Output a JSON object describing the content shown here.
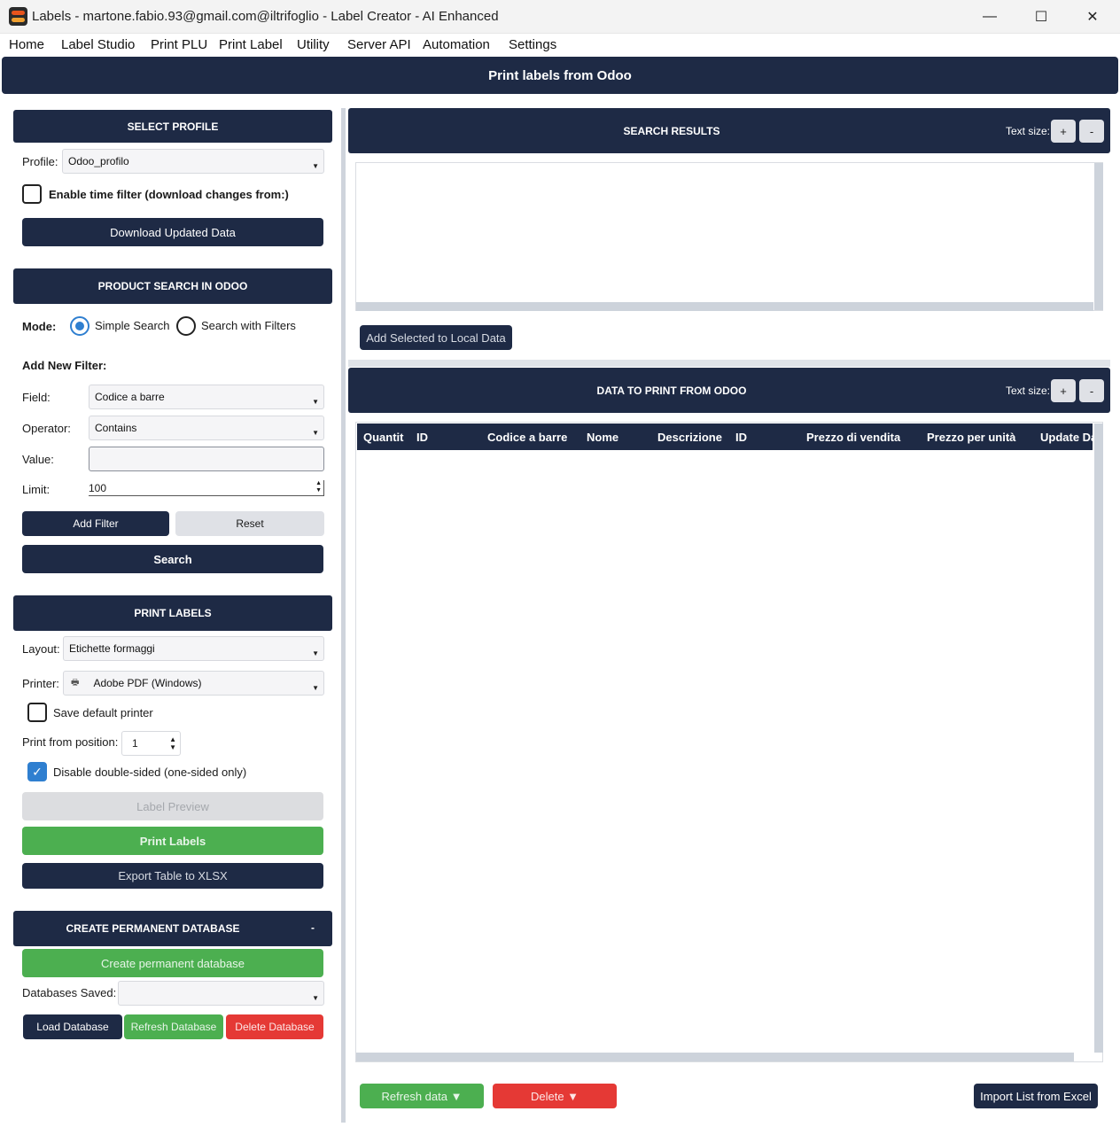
{
  "window": {
    "title": "Labels - martone.fabio.93@gmail.com@iltrifoglio - Label Creator - AI Enhanced",
    "minimize": "—",
    "maximize": "☐",
    "close": "✕"
  },
  "menu": [
    "Home",
    "Label Studio",
    "Print PLU",
    "Print Label",
    "Utility",
    "Server API",
    "Automation",
    "Settings"
  ],
  "header": {
    "title": "Print labels from Odoo"
  },
  "profile": {
    "section": "SELECT PROFILE",
    "label": "Profile:",
    "value": "Odoo_profilo",
    "time_filter_label": "Enable time filter (download changes from:)",
    "download_button": "Download Updated Data"
  },
  "search": {
    "section": "PRODUCT SEARCH IN ODOO",
    "mode_label": "Mode:",
    "mode_simple": "Simple Search",
    "mode_filters": "Search with Filters",
    "add_filter_title": "Add New Filter:",
    "field_label": "Field:",
    "field_value": "Codice a barre",
    "operator_label": "Operator:",
    "operator_value": "Contains",
    "value_label": "Value:",
    "value_value": "",
    "limit_label": "Limit:",
    "limit_value": "100",
    "add_filter_button": "Add Filter",
    "reset_button": "Reset",
    "search_button": "Search"
  },
  "print": {
    "section": "PRINT LABELS",
    "layout_label": "Layout:",
    "layout_value": "Etichette formaggi",
    "printer_label": "Printer:",
    "printer_value": "Adobe PDF (Windows)",
    "save_default_label": "Save default printer",
    "position_label": "Print from position:",
    "position_value": "1",
    "disable_double_label": "Disable double-sided (one-sided only)",
    "preview_button": "Label Preview",
    "print_button": "Print Labels",
    "export_button": "Export Table to XLSX"
  },
  "database": {
    "section": "CREATE PERMANENT DATABASE",
    "collapse": "-",
    "create_button": "Create permanent database",
    "saved_label": "Databases Saved:",
    "saved_value": "",
    "load_button": "Load Database",
    "refresh_button": "Refresh Database",
    "delete_button": "Delete Database"
  },
  "results": {
    "section": "SEARCH RESULTS",
    "text_size_label": "Text size:",
    "plus": "+",
    "minus": "-",
    "add_selected_button": "Add Selected to Local Data"
  },
  "data_to_print": {
    "section": "DATA TO PRINT FROM ODOO",
    "text_size_label": "Text size:",
    "plus": "+",
    "minus": "-",
    "columns": [
      "Quantit",
      "ID",
      "Codice a barre",
      "Nome",
      "Descrizione",
      "ID",
      "Prezzo di vendita",
      "Prezzo per unità",
      "Update Da"
    ],
    "refresh_button": "Refresh data ▼",
    "delete_button": "Delete ▼",
    "import_button": "Import List from Excel"
  },
  "colors": {
    "navy": "#1e2a45",
    "green": "#4caf50",
    "red": "#e53935",
    "accent": "#2f7fd0"
  }
}
